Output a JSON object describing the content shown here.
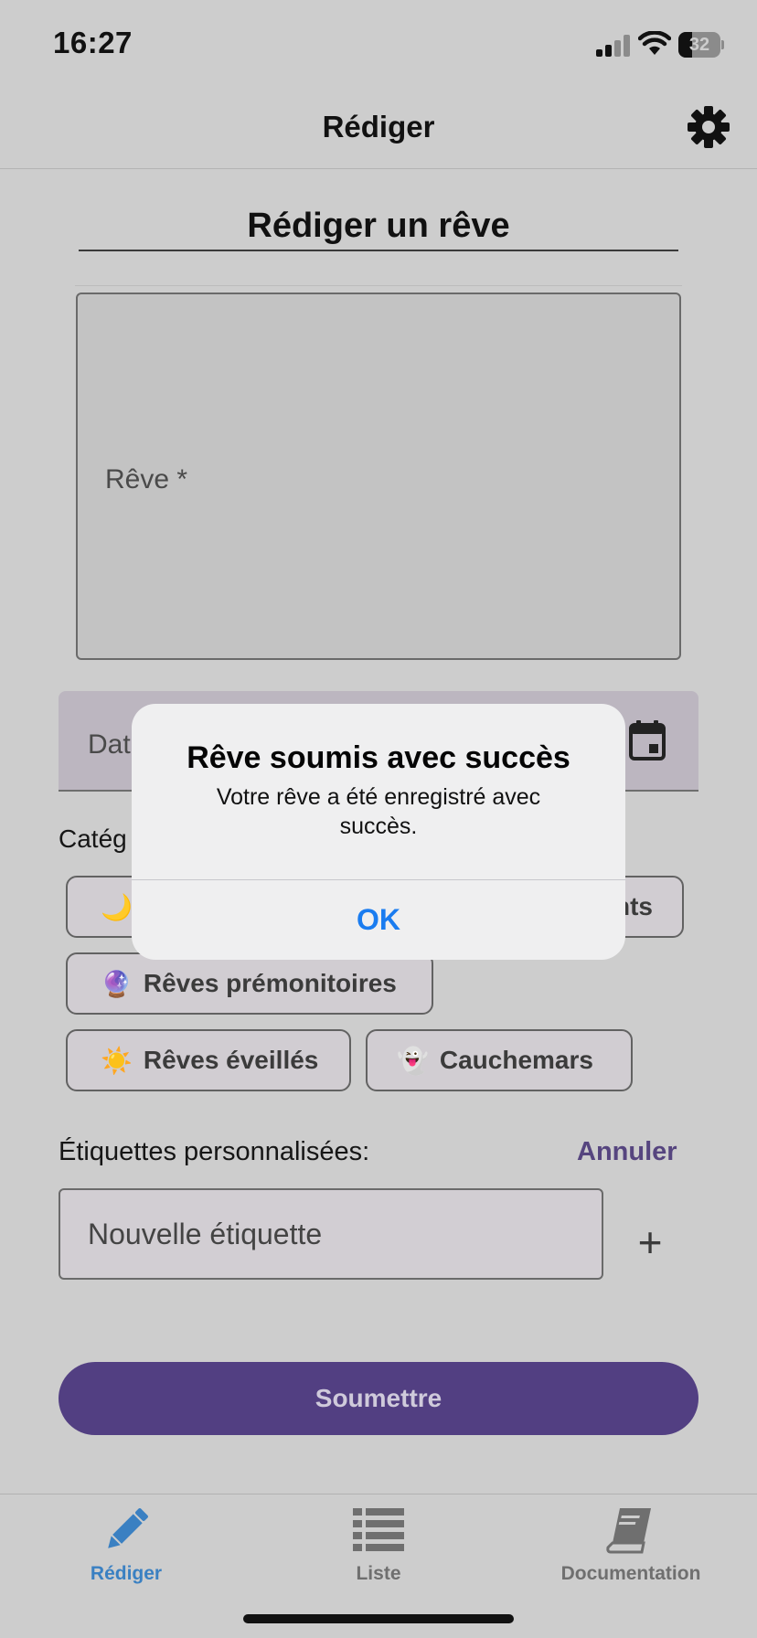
{
  "status": {
    "time": "16:27",
    "battery": "32",
    "battery_level": 0.32
  },
  "header": {
    "title": "Rédiger",
    "settings_icon": "gear-icon"
  },
  "form": {
    "heading": "Rédiger un rêve",
    "dream_label": "Rêve *",
    "date_label_visible": "Dat",
    "calendar_icon": "calendar-icon",
    "categories_label_visible": "Catég",
    "chips": {
      "lucid_emoji": "🌙",
      "lucid_tail": "nts",
      "premonitory_emoji": "🔮",
      "premonitory": "Rêves prémonitoires",
      "awake_emoji": "☀️",
      "awake": "Rêves éveillés",
      "nightmare_emoji": "👻",
      "nightmare": "Cauchemars"
    },
    "custom_tags_label": "Étiquettes personnalisées:",
    "cancel": "Annuler",
    "new_tag_placeholder": "Nouvelle étiquette",
    "add_symbol": "+",
    "submit": "Soumettre"
  },
  "alert": {
    "title": "Rêve soumis avec succès",
    "message": "Votre rêve a été enregistré avec succès.",
    "ok": "OK"
  },
  "tabs": [
    {
      "label": "Rédiger",
      "icon": "pencil-icon",
      "active": true
    },
    {
      "label": "Liste",
      "icon": "list-icon",
      "active": false
    },
    {
      "label": "Documentation",
      "icon": "book-icon",
      "active": false
    }
  ],
  "colors": {
    "accent": "#523f82",
    "tab_active": "#3a80c2",
    "alert_button": "#1a7cf0"
  }
}
